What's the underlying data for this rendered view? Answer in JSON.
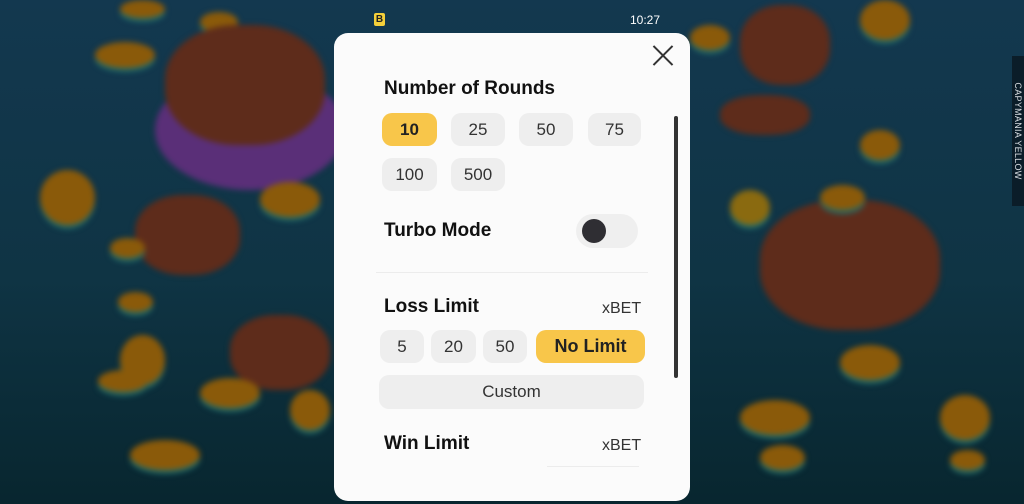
{
  "status_bar": {
    "badge": "B",
    "time": "10:27"
  },
  "side_tab": {
    "label": "CAPYMANIA YELLOW"
  },
  "modal": {
    "close_icon": "close-icon",
    "rounds": {
      "title": "Number of Rounds",
      "options": [
        "10",
        "25",
        "50",
        "75",
        "100",
        "500"
      ],
      "selected": "10"
    },
    "turbo": {
      "title": "Turbo Mode",
      "enabled": false
    },
    "loss_limit": {
      "title": "Loss Limit",
      "unit": "xBET",
      "options": [
        "5",
        "20",
        "50",
        "No Limit"
      ],
      "selected": "No Limit",
      "custom_label": "Custom"
    },
    "win_limit": {
      "title": "Win Limit",
      "unit": "xBET"
    }
  },
  "colors": {
    "accent": "#f8c64a",
    "chip": "#eeeeee",
    "modal_bg": "#fbfbfb",
    "background": "#13384f"
  }
}
